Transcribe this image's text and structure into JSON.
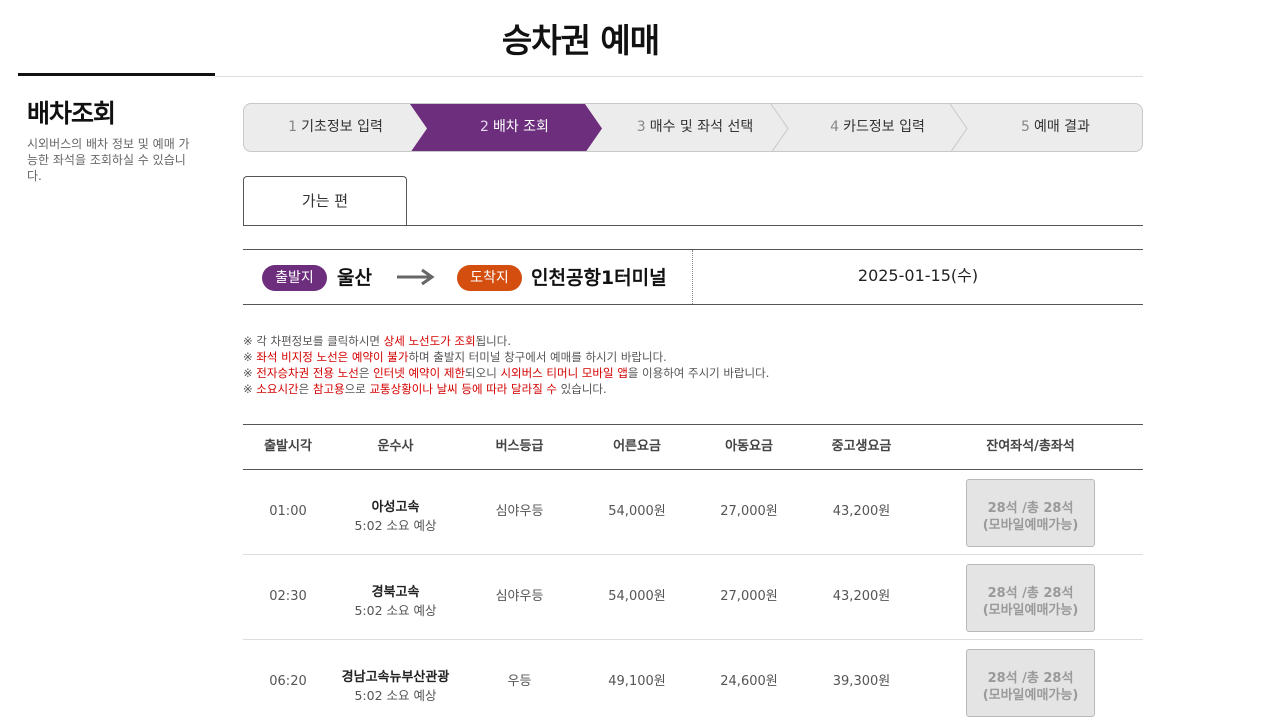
{
  "page_title": "승차권 예매",
  "sidebar": {
    "title": "배차조회",
    "description": "시외버스의 배차 정보 및 예매 가능한 좌석을 조회하실 수 있습니다."
  },
  "steps": [
    {
      "num": "1",
      "label": "기초정보 입력"
    },
    {
      "num": "2",
      "label": "배차 조회"
    },
    {
      "num": "3",
      "label": "매수 및 좌석 선택"
    },
    {
      "num": "4",
      "label": "카드정보 입력"
    },
    {
      "num": "5",
      "label": "예매 결과"
    }
  ],
  "active_step": 2,
  "colors": {
    "active_step": "#6d2f7d",
    "departure_badge": "#6d2f7d",
    "arrival_badge": "#d44e10",
    "notice_red": "#d40000"
  },
  "direction_tab": "가는 편",
  "route": {
    "departure_badge": "출발지",
    "departure": "울산",
    "arrival_badge": "도착지",
    "arrival": "인천공항1터미널",
    "date": "2025-01-15(수)"
  },
  "notes": [
    [
      {
        "t": "※ 각 차편정보를 클릭하시면 "
      },
      {
        "t": "상세 노선도가 조회",
        "red": true
      },
      {
        "t": "됩니다."
      }
    ],
    [
      {
        "t": "※ "
      },
      {
        "t": "좌석 비지정 노선은 예약이 불가",
        "red": true
      },
      {
        "t": "하며 출발지 터미널 창구에서 예매를 하시기 바랍니다."
      }
    ],
    [
      {
        "t": "※ "
      },
      {
        "t": "전자승차권 전용 노선",
        "red": true
      },
      {
        "t": "은 "
      },
      {
        "t": "인터넷 예약이 제한",
        "red": true
      },
      {
        "t": "되오니 "
      },
      {
        "t": "시외버스 티머니 모바일 앱",
        "red": true
      },
      {
        "t": "을 이용하여 주시기 바랍니다."
      }
    ],
    [
      {
        "t": "※ "
      },
      {
        "t": "소요시간",
        "red": true
      },
      {
        "t": "은 "
      },
      {
        "t": "참고용",
        "red": true
      },
      {
        "t": "으로 "
      },
      {
        "t": "교통상황이나 날씨 등에 따라 달라질 수",
        "red": true
      },
      {
        "t": " 있습니다."
      }
    ]
  ],
  "table": {
    "headers": [
      "출발시각",
      "운수사",
      "버스등급",
      "어른요금",
      "아동요금",
      "중고생요금",
      "잔여좌석/총좌석"
    ],
    "rows": [
      {
        "time": "01:00",
        "company": "아성고속",
        "duration": "5:02 소요 예상",
        "grade": "심야우등",
        "adult": "54,000원",
        "child": "27,000원",
        "youth": "43,200원",
        "seats": "28석 /총 28석",
        "note": "(모바일예매가능)"
      },
      {
        "time": "02:30",
        "company": "경북고속",
        "duration": "5:02 소요 예상",
        "grade": "심야우등",
        "adult": "54,000원",
        "child": "27,000원",
        "youth": "43,200원",
        "seats": "28석 /총 28석",
        "note": "(모바일예매가능)"
      },
      {
        "time": "06:20",
        "company": "경남고속뉴부산관광",
        "duration": "5:02 소요 예상",
        "grade": "우등",
        "adult": "49,100원",
        "child": "24,600원",
        "youth": "39,300원",
        "seats": "28석 /총 28석",
        "note": "(모바일예매가능)"
      }
    ]
  }
}
